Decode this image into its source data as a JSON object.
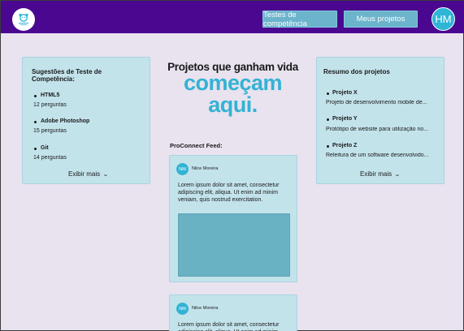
{
  "header": {
    "logo_icon": "app-logo-icon",
    "nav": {
      "tests_label": "Testes de competência",
      "projects_label": "Meus projetos"
    },
    "user_initials": "HM"
  },
  "colors": {
    "topbar": "#4A0890",
    "accent": "#33B3D3",
    "card": "#C3E3EB",
    "nav_button": "#6BB4CC",
    "background": "#E9E2EF"
  },
  "tests_card": {
    "title": "Sugestões de Teste de Competência:",
    "items": [
      {
        "name": "HTML5",
        "count": "12 perguntas"
      },
      {
        "name": "Adobe Photoshop",
        "count": "15 perguntas"
      },
      {
        "name": "Git",
        "count": "14 perguntas"
      }
    ],
    "show_more": "Exibir mais"
  },
  "hero": {
    "line1": "Projetos que ganham vida",
    "line2": "começam",
    "line3": "aqui."
  },
  "feed": {
    "label": "ProConnect Feed:",
    "posts": [
      {
        "initials": "NM",
        "author": "Nilce Moreira",
        "text": "Lorem ipsum dolor sit amet, consectetur adipiscing elit, aliqua. Ut enim ad minim veniam, quis nostrud exercitation."
      },
      {
        "initials": "NM",
        "author": "Nilce Moreira",
        "text": "Lorem ipsum dolor sit amet, consectetur adipiscing elit, aliqua. Ut enim ad minim"
      }
    ]
  },
  "projects_card": {
    "title": "Resumo dos projetos",
    "items": [
      {
        "name": "Projeto X",
        "desc": "Projeto de desenvolvimento mobile de..."
      },
      {
        "name": "Projeto Y",
        "desc": "Protótipo de website para utilização no..."
      },
      {
        "name": "Projeto Z",
        "desc": "Releitura de um software desenvolvido..."
      }
    ],
    "show_more": "Exibir mais"
  }
}
